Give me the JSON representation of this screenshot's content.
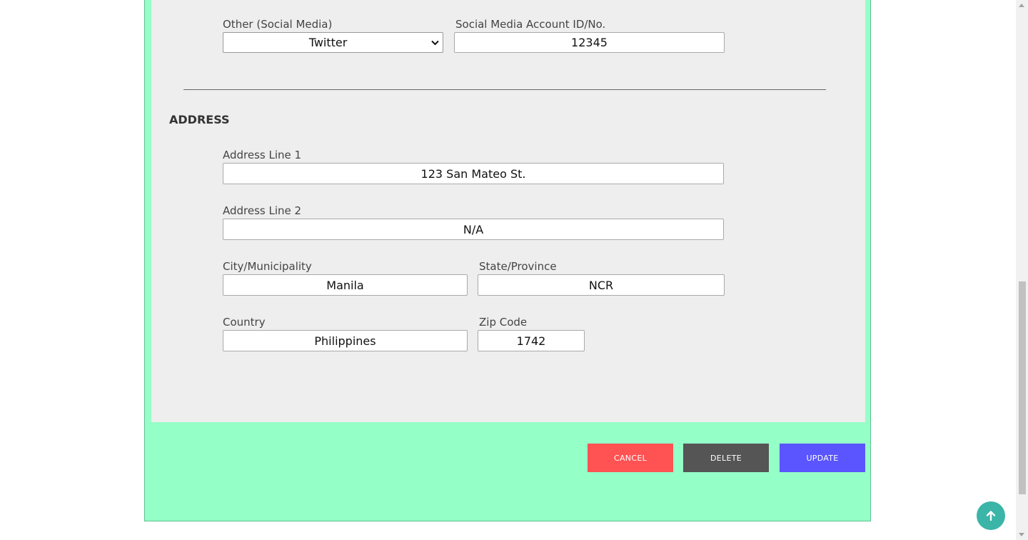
{
  "social": {
    "other_label": "Other (Social Media)",
    "other_value": "Twitter",
    "account_label": "Social Media Account ID/No.",
    "account_value": "12345"
  },
  "address": {
    "title": "ADDRESS",
    "line1_label": "Address Line 1",
    "line1_value": "123 San Mateo St.",
    "line2_label": "Address Line 2",
    "line2_value": "N/A",
    "city_label": "City/Municipality",
    "city_value": "Manila",
    "state_label": "State/Province",
    "state_value": "NCR",
    "country_label": "Country",
    "country_value": "Philippines",
    "zip_label": "Zip Code",
    "zip_value": "1742"
  },
  "actions": {
    "cancel_label": "CANCEL",
    "delete_label": "DELETE",
    "update_label": "UPDATE"
  },
  "icons": {
    "select_chevron": "chevron-down-icon",
    "back_to_top": "arrow-up-icon"
  },
  "colors": {
    "outer_bg": "#95ffc8",
    "panel_bg": "#eeeeee",
    "cancel": "#ff5252",
    "delete": "#555555",
    "update": "#5a55ff",
    "to_top": "#3ab5a8"
  }
}
